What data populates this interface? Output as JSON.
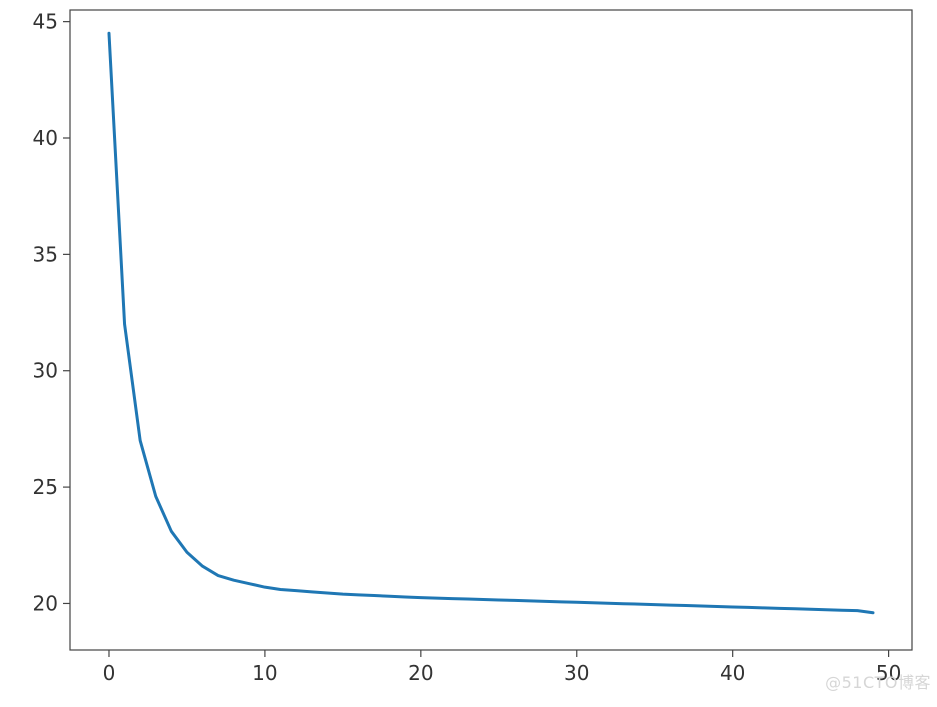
{
  "chart_data": {
    "type": "line",
    "x": [
      0,
      1,
      2,
      3,
      4,
      5,
      6,
      7,
      8,
      9,
      10,
      11,
      12,
      13,
      14,
      15,
      16,
      17,
      18,
      19,
      20,
      21,
      22,
      23,
      24,
      25,
      26,
      27,
      28,
      29,
      30,
      31,
      32,
      33,
      34,
      35,
      36,
      37,
      38,
      39,
      40,
      41,
      42,
      43,
      44,
      45,
      46,
      47,
      48,
      49
    ],
    "values": [
      44.5,
      32.0,
      27.0,
      24.6,
      23.1,
      22.2,
      21.6,
      21.2,
      21.0,
      20.85,
      20.7,
      20.6,
      20.55,
      20.5,
      20.45,
      20.4,
      20.37,
      20.34,
      20.31,
      20.28,
      20.25,
      20.23,
      20.21,
      20.19,
      20.17,
      20.15,
      20.13,
      20.11,
      20.09,
      20.07,
      20.05,
      20.03,
      20.01,
      19.99,
      19.97,
      19.95,
      19.93,
      19.91,
      19.89,
      19.87,
      19.85,
      19.83,
      19.81,
      19.79,
      19.77,
      19.75,
      19.73,
      19.71,
      19.69,
      19.6
    ],
    "title": "",
    "xlabel": "",
    "ylabel": "",
    "xlim": [
      -2.5,
      51.5
    ],
    "ylim": [
      18.0,
      45.5
    ],
    "xticks": [
      0,
      10,
      20,
      30,
      40,
      50
    ],
    "yticks": [
      20,
      25,
      30,
      35,
      40,
      45
    ],
    "line_color": "#1f77b4",
    "grid": false
  },
  "xtick_labels": {
    "0": "0",
    "1": "10",
    "2": "20",
    "3": "30",
    "4": "40",
    "5": "50"
  },
  "ytick_labels": {
    "0": "20",
    "1": "25",
    "2": "30",
    "3": "35",
    "4": "40",
    "5": "45"
  },
  "watermark": "@51CTO博客"
}
